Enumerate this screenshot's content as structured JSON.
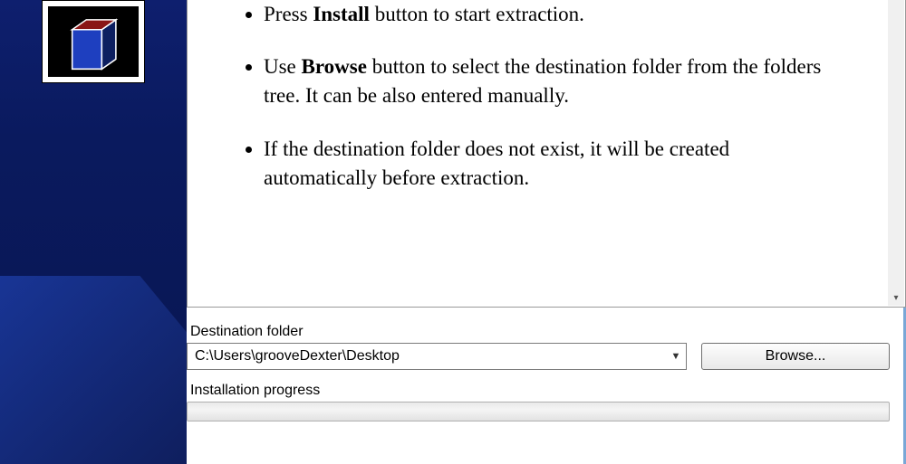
{
  "sidebar": {
    "icon": "package-box-icon"
  },
  "instructions": {
    "items": [
      {
        "pre": "Press ",
        "bold": "Install",
        "post": " button to start extraction."
      },
      {
        "pre": "Use ",
        "bold": "Browse",
        "post": " button to select the destination folder from the folders tree. It can be also entered manually."
      },
      {
        "pre": "",
        "bold": "",
        "post": "If the destination folder does not exist, it will be created automatically before extraction."
      }
    ]
  },
  "form": {
    "dest_label": "Destination folder",
    "dest_value": "C:\\Users\\grooveDexter\\Desktop",
    "browse_label": "Browse...",
    "progress_label": "Installation progress",
    "progress_value": 0
  }
}
